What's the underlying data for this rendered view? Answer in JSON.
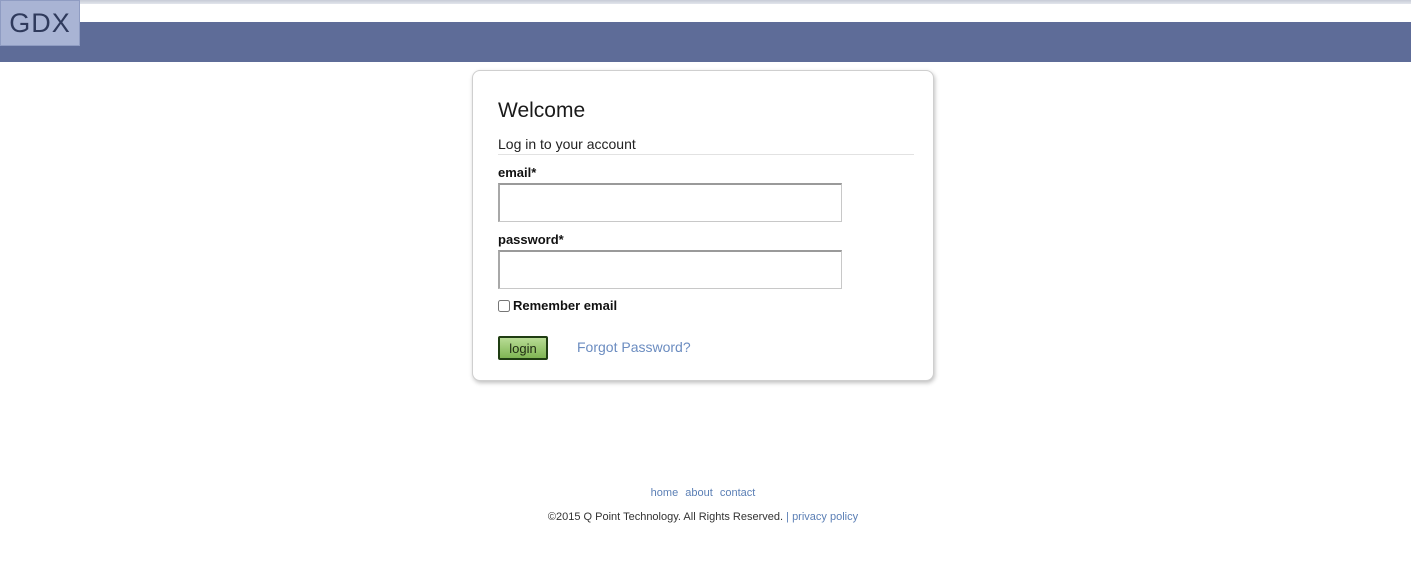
{
  "header": {
    "logo_text": "GDX",
    "bar_color": "#5e6c98",
    "logo_color": "#a9b4d4"
  },
  "login": {
    "title": "Welcome",
    "subtitle": "Log in to your account",
    "email_label": "email*",
    "email_value": "",
    "password_label": "password*",
    "password_value": "",
    "remember_label": "Remember email",
    "remember_checked": false,
    "login_button": "login",
    "forgot_link": "Forgot Password?"
  },
  "footer": {
    "links": [
      "home",
      "about",
      "contact"
    ],
    "copyright": "©2015 Q Point Technology. All Rights Reserved.",
    "separator": "|",
    "privacy_link": "privacy policy"
  },
  "colors": {
    "link": "#6b8cc0",
    "button_green": "#8fc262"
  }
}
